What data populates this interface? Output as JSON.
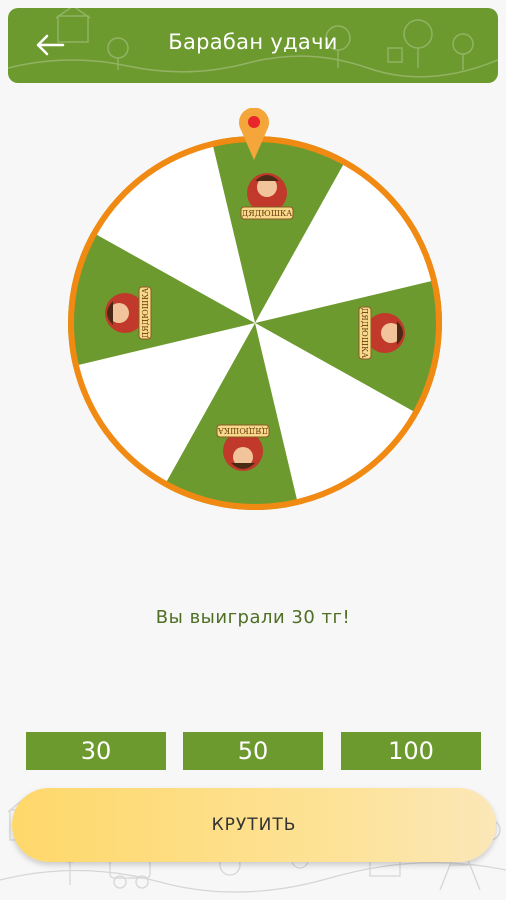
{
  "header": {
    "back_icon": "arrow-left-icon",
    "title": "Барабан удачи"
  },
  "wheel": {
    "segments": 8,
    "colors": {
      "green": "#6d9a2f",
      "white": "#ffffff",
      "rim": "#f08a12",
      "pointer_dot": "#e8262b"
    },
    "mascot_banner_text": "ДЯДЮШКА"
  },
  "result": {
    "text": "Вы выиграли 30 тг!"
  },
  "bets": [
    {
      "label": "30"
    },
    {
      "label": "50"
    },
    {
      "label": "100"
    }
  ],
  "spin_button": {
    "label": "КРУТИТЬ"
  }
}
